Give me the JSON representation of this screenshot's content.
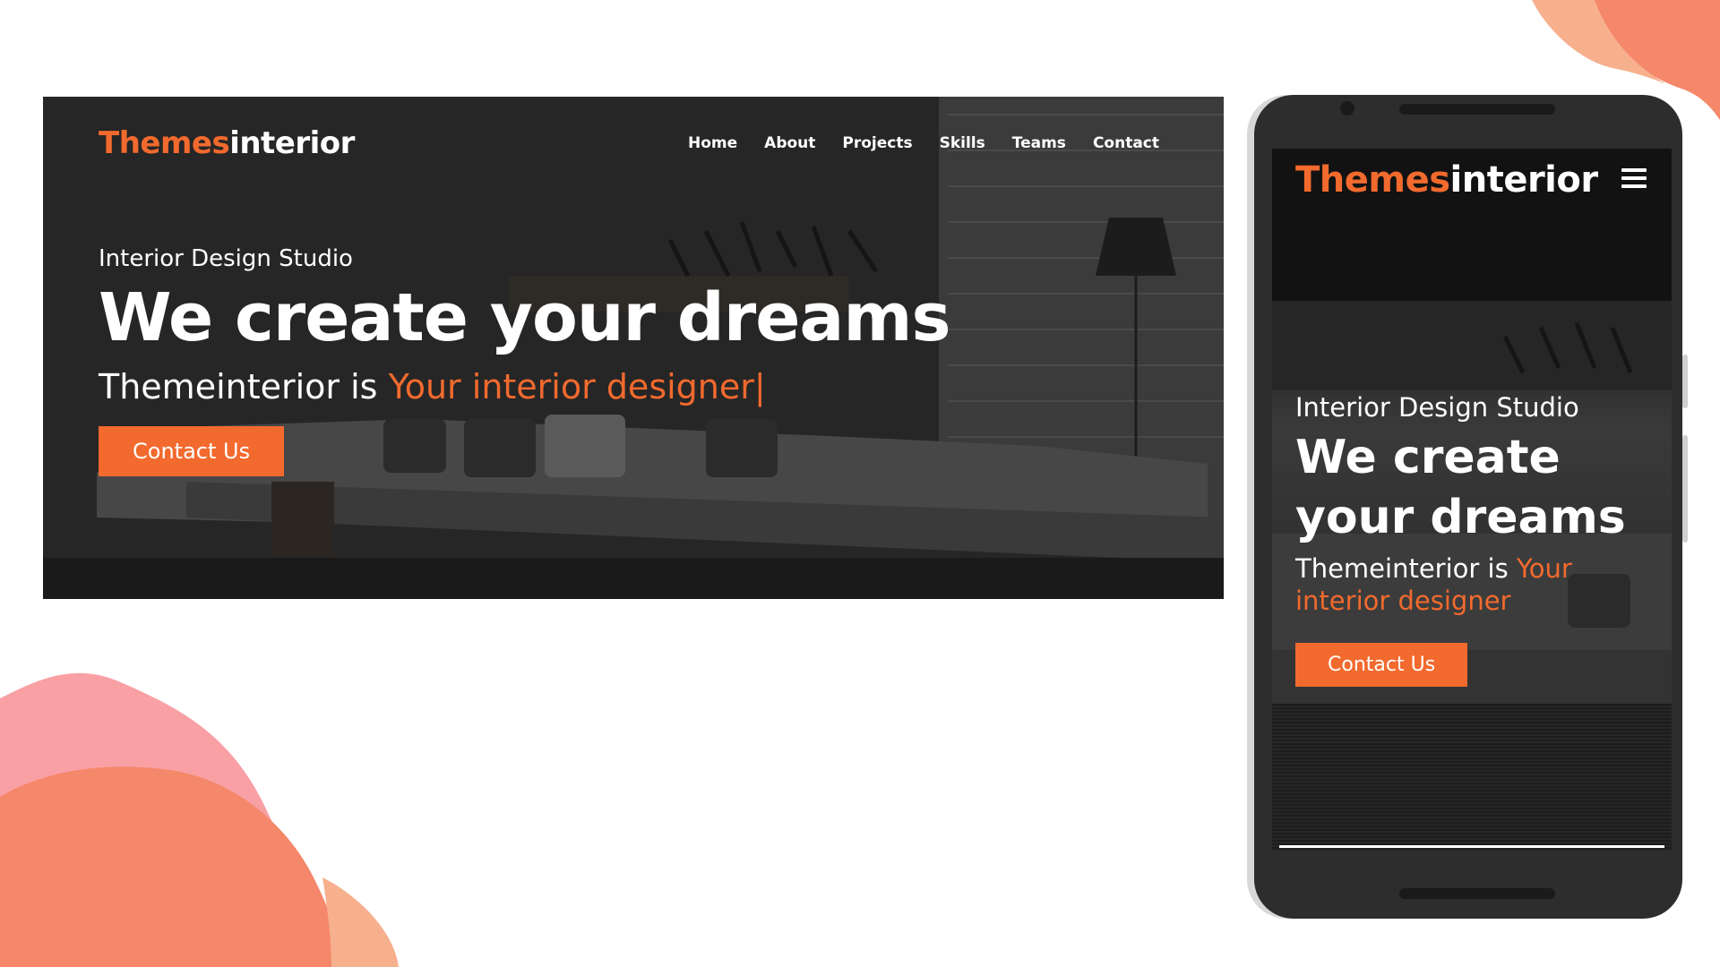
{
  "colors": {
    "accent": "#f26a2e",
    "blob_pink": "#f9a0a5",
    "blob_orange": "#f5876a",
    "blob_peach": "#f7b08e"
  },
  "desktop": {
    "logo": {
      "accent": "Themes",
      "plain": "interior"
    },
    "nav": [
      "Home",
      "About",
      "Projects",
      "Skills",
      "Teams",
      "Contact"
    ],
    "hero": {
      "eyebrow": "Interior Design Studio",
      "headline": "We create your dreams",
      "tagline_prefix": "Themeinterior is ",
      "tagline_accent": "Your interior designer",
      "cursor": "|",
      "button": "Contact Us"
    }
  },
  "mobile": {
    "logo": {
      "accent": "Themes",
      "plain": "interior"
    },
    "menu_icon": "hamburger-menu-icon",
    "hero": {
      "eyebrow": "Interior Design Studio",
      "headline_line1": "We create",
      "headline_line2": "your dreams",
      "tagline_prefix": "Themeinterior is ",
      "tagline_accent": "Your interior designer",
      "button": "Contact Us"
    }
  }
}
